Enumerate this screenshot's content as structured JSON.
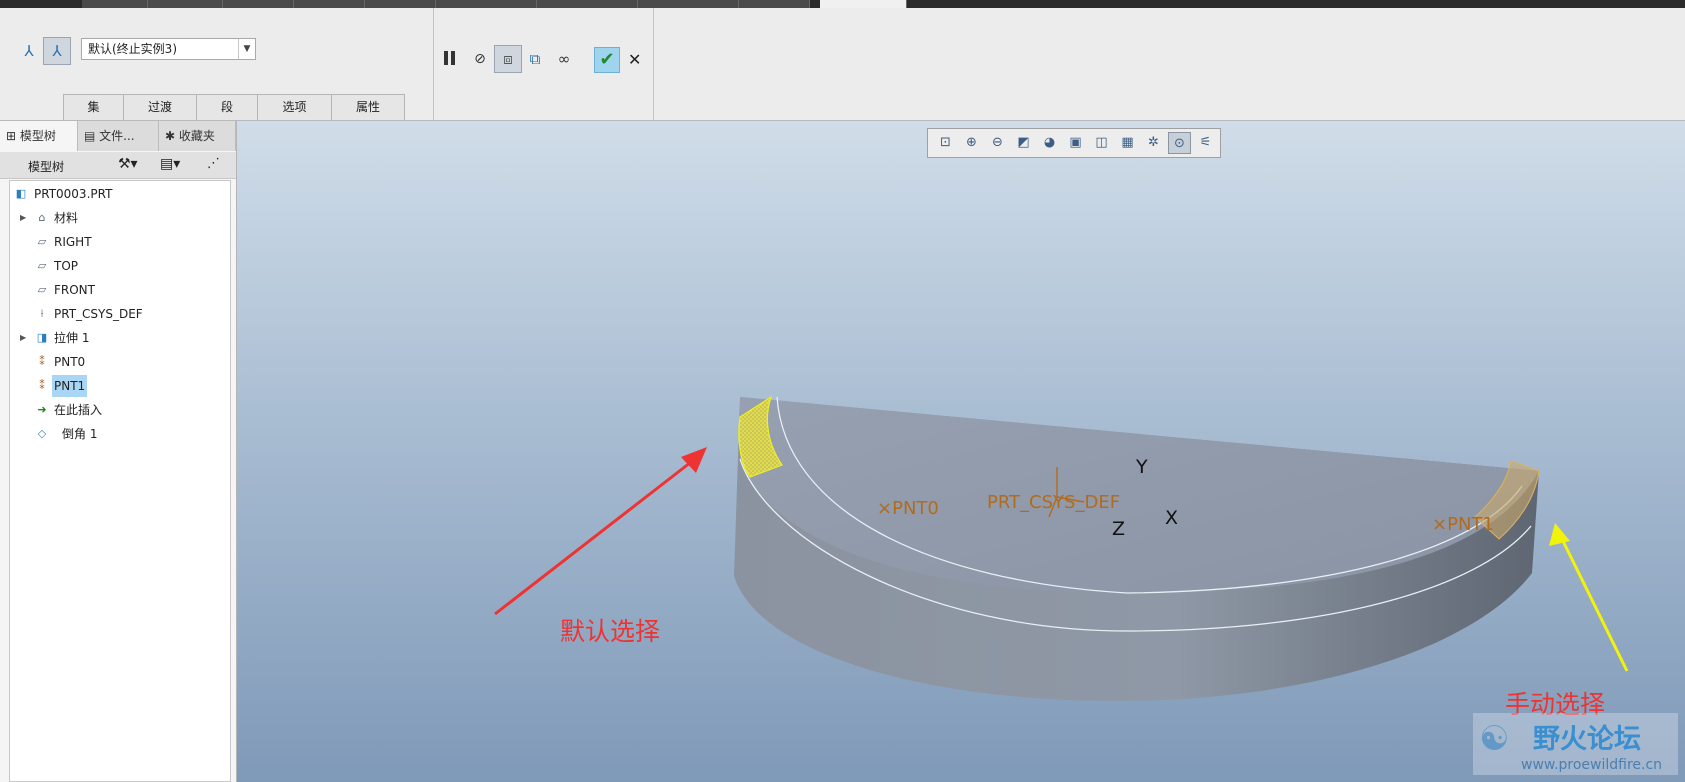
{
  "ribbon": {
    "combo_value": "默认(终止实例3)",
    "tabs": [
      "集",
      "过渡",
      "段",
      "选项",
      "属性"
    ],
    "icons": [
      "round-set-icon",
      "round-transition-icon",
      "pause-icon",
      "no-preview-icon",
      "geometry-preview-icon",
      "verify-mode-icon",
      "glasses-icon",
      "ok-check-icon",
      "cancel-x-icon"
    ]
  },
  "left": {
    "tabs": [
      "模型树",
      "文件...",
      "收藏夹"
    ],
    "tree_header": "模型树",
    "items": [
      {
        "label": "PRT0003.PRT",
        "icon": "part-icon"
      },
      {
        "label": "材料",
        "icon": "material-icon",
        "expand": "▶"
      },
      {
        "label": "RIGHT",
        "icon": "datum-plane-icon"
      },
      {
        "label": "TOP",
        "icon": "datum-plane-icon"
      },
      {
        "label": "FRONT",
        "icon": "datum-plane-icon"
      },
      {
        "label": "PRT_CSYS_DEF",
        "icon": "csys-icon"
      },
      {
        "label": "拉伸 1",
        "icon": "extrude-icon",
        "expand": "▶"
      },
      {
        "label": "PNT0",
        "icon": "datum-point-icon"
      },
      {
        "label": "PNT1",
        "icon": "datum-point-icon",
        "selected": true
      },
      {
        "label": "在此插入",
        "icon": "insert-here-icon"
      },
      {
        "label": "倒角 1",
        "icon": "round-feature-icon"
      }
    ]
  },
  "viewport": {
    "toolbar_icons": [
      "refit-icon",
      "zoom-in-icon",
      "zoom-out-icon",
      "repaint-icon",
      "display-style-icon",
      "saved-orientation-icon",
      "view-manager-icon",
      "perspective-icon",
      "datum-display-icon",
      "spin-center-icon",
      "annotation-display-icon"
    ],
    "labels": {
      "csys": "PRT_CSYS_DEF",
      "axis_x": "X",
      "axis_y": "Y",
      "axis_z": "Z",
      "pnt0": "PNT0",
      "pnt1": "PNT1",
      "default_select": "默认选择",
      "manual_select": "手动选择",
      "watermark_cn": "野火论坛",
      "watermark_url": "www.proewildfire.cn"
    },
    "colors": {
      "datum_label": "#b36b1a",
      "red_annotation": "#ee3333",
      "yellow_annotation": "#f2f20a"
    }
  }
}
